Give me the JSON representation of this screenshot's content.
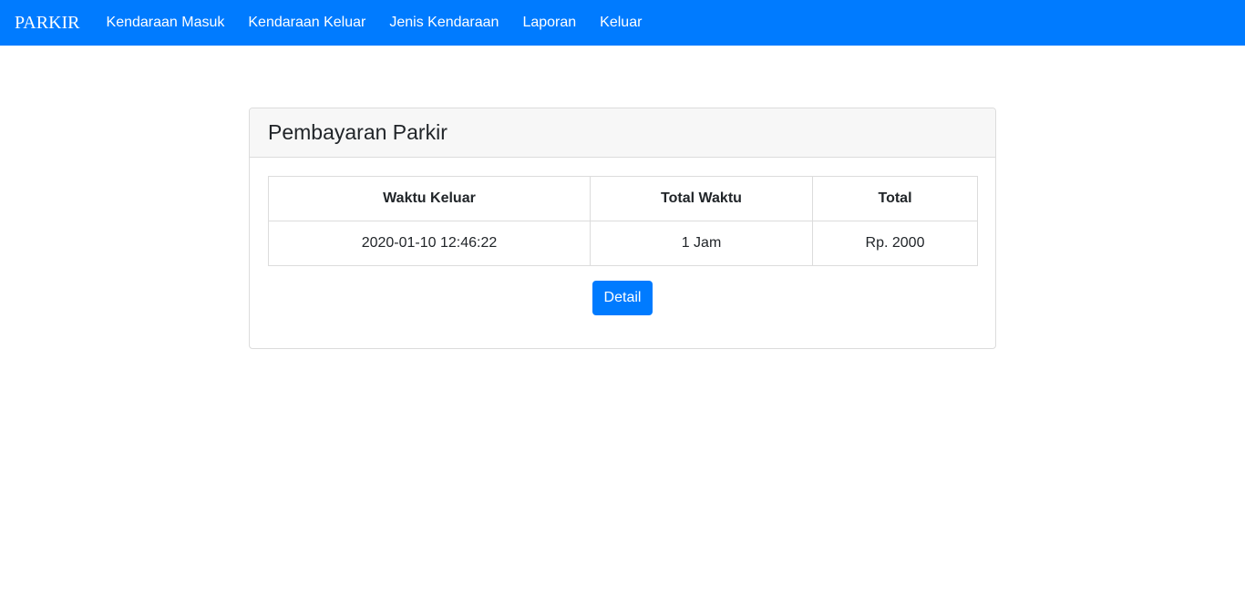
{
  "navbar": {
    "brand": "PARKIR",
    "items": [
      {
        "label": "Kendaraan Masuk"
      },
      {
        "label": "Kendaraan Keluar"
      },
      {
        "label": "Jenis Kendaraan"
      },
      {
        "label": "Laporan"
      },
      {
        "label": "Keluar"
      }
    ],
    "color": "#007bff"
  },
  "card": {
    "title": "Pembayaran Parkir",
    "table": {
      "headers": [
        "Waktu Keluar",
        "Total Waktu",
        "Total"
      ],
      "rows": [
        [
          "2020-01-10 12:46:22",
          "1 Jam",
          "Rp. 2000"
        ]
      ]
    },
    "detail_button": "Detail"
  }
}
